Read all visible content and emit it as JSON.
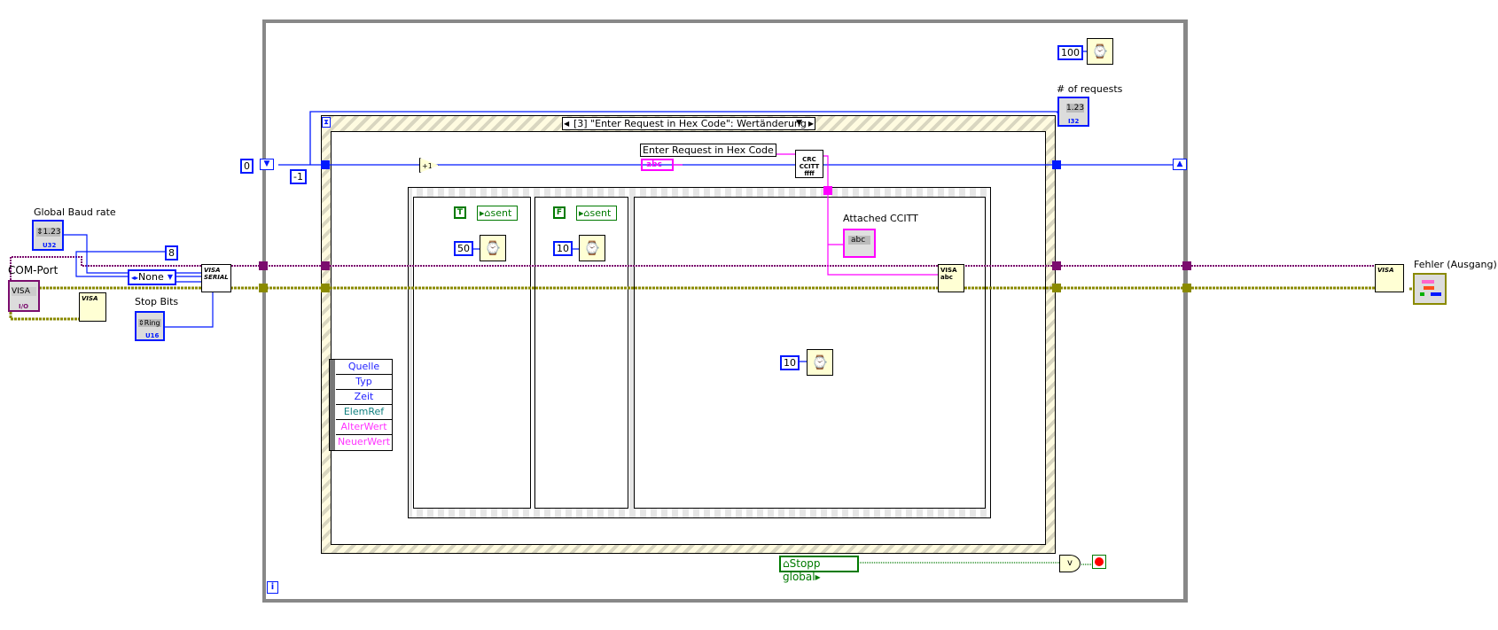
{
  "while_loop": {
    "iteration_label": "i"
  },
  "event_structure": {
    "selector_label": "[3] \"Enter Request in Hex Code\": Wertänderung",
    "event_data": [
      {
        "label": "Quelle",
        "color": "#1f1fff"
      },
      {
        "label": "Typ",
        "color": "#1f1fff"
      },
      {
        "label": "Zeit",
        "color": "#1f1fff"
      },
      {
        "label": "ElemRef",
        "color": "#118080"
      },
      {
        "label": "AlterWert",
        "color": "#ff33ff"
      },
      {
        "label": "NeuerWert",
        "color": "#ff33ff"
      }
    ]
  },
  "constants": {
    "shift_init": "0",
    "minus_one": "-1",
    "data_bits": "8",
    "parity": "None",
    "wait_top": "100",
    "wait_50": "50",
    "wait_10a": "10",
    "wait_10b": "10",
    "true_const": "T",
    "false_const": "F"
  },
  "controls": {
    "baud_rate": {
      "label": "Global Baud rate",
      "value": "1.23",
      "type": "U32"
    },
    "com_port": {
      "label": "COM-Port",
      "value": "VISA",
      "type": "I/O"
    },
    "stop_bits": {
      "label": "Stop Bits",
      "value": "Ring",
      "type": "U16"
    },
    "request": {
      "label": "Enter Request in Hex Code",
      "value": "abc"
    }
  },
  "indicators": {
    "num_requests": {
      "label": "# of requests",
      "value": "1.23",
      "type": "I32"
    },
    "attached_ccitt": {
      "label": "Attached CCITT",
      "value": "abc"
    },
    "error_out": {
      "label": "Fehler (Ausgang)"
    }
  },
  "locals": {
    "sent": "sent",
    "stopp_global": "Stopp global"
  },
  "nodes": {
    "visa_serial": "VISA\nSERIAL",
    "crc": "CRC\nCCITT\nffff",
    "visa_write": "VISA\nabc",
    "visa_close": "VISA",
    "visa_open": "VISA",
    "or_gate": "v"
  },
  "colors": {
    "numeric_wire": "#0019ff",
    "string_wire": "#ff00ff",
    "visa_wire": "#7b0c6e",
    "error_wire": "#8a8a00",
    "bool_wire": "#007a00"
  }
}
